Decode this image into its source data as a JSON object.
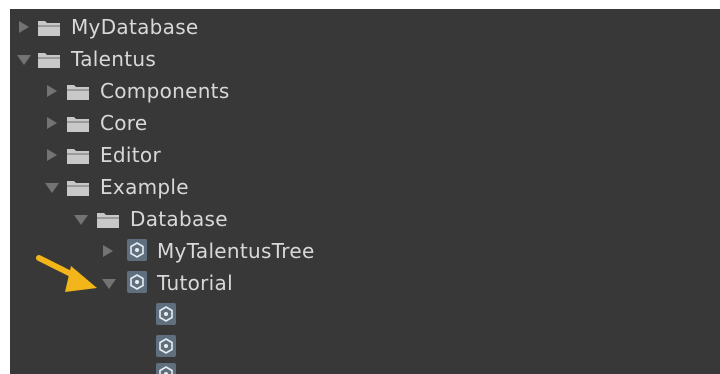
{
  "tree": {
    "nodes": [
      {
        "label": "MyDatabase",
        "type": "folder",
        "state": "collapsed",
        "depth": 0
      },
      {
        "label": "Talentus",
        "type": "folder",
        "state": "expanded",
        "depth": 0
      },
      {
        "label": "Components",
        "type": "folder",
        "state": "collapsed",
        "depth": 1
      },
      {
        "label": "Core",
        "type": "folder",
        "state": "collapsed",
        "depth": 1
      },
      {
        "label": "Editor",
        "type": "folder",
        "state": "collapsed",
        "depth": 1
      },
      {
        "label": "Example",
        "type": "folder",
        "state": "expanded",
        "depth": 1
      },
      {
        "label": "Database",
        "type": "folder",
        "state": "expanded",
        "depth": 2
      },
      {
        "label": "MyTalentusTree",
        "type": "asset",
        "state": "collapsed",
        "depth": 3
      },
      {
        "label": "Tutorial",
        "type": "asset",
        "state": "expanded",
        "depth": 3
      },
      {
        "label": "",
        "type": "asset",
        "state": "none",
        "depth": 4
      },
      {
        "label": "",
        "type": "asset",
        "state": "none",
        "depth": 4
      },
      {
        "label": "",
        "type": "asset",
        "state": "none",
        "depth": 4
      }
    ]
  },
  "annotation": {
    "icon": "arrow-right-icon",
    "color": "#f2b61a",
    "points_to": "Tutorial"
  },
  "colors": {
    "panel_background": "#383838",
    "text": "#d8d8d8",
    "folder_icon": "#c8c8c8",
    "asset_icon": "#5f6f7e",
    "foldout_arrow": "#737373"
  }
}
